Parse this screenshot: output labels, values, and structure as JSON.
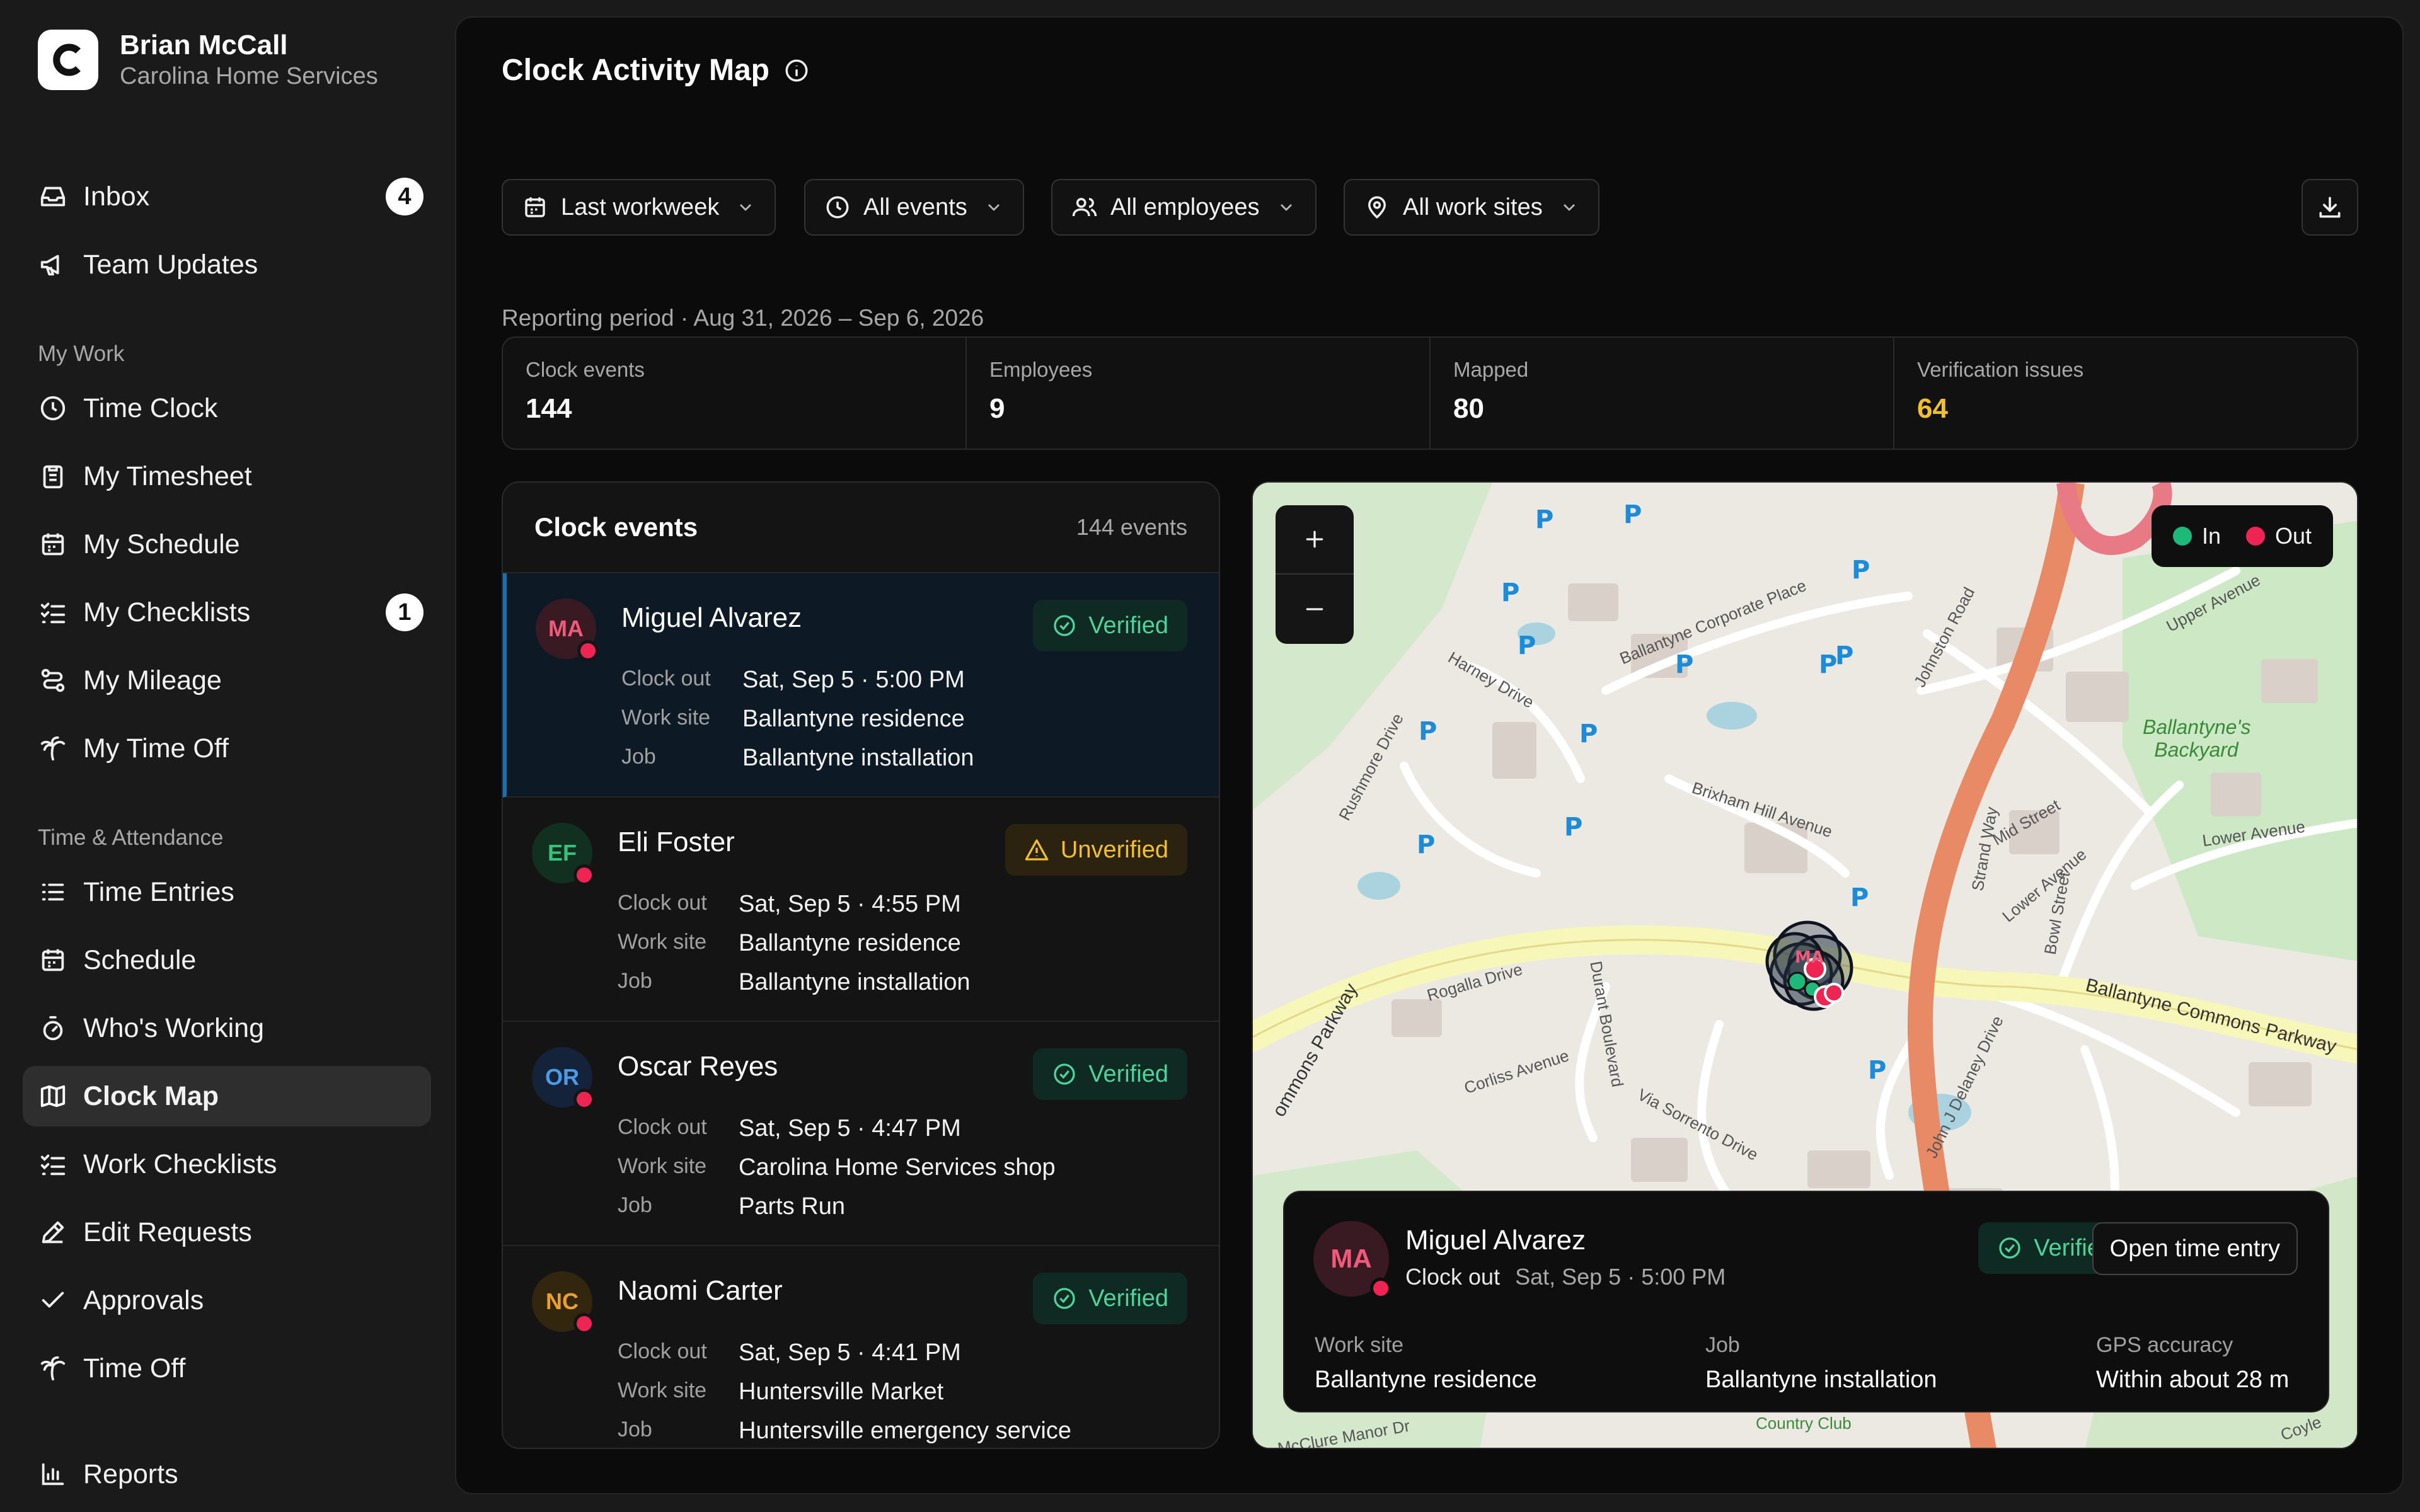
{
  "user": {
    "name": "Brian McCall",
    "org": "Carolina Home Services"
  },
  "nav": {
    "inbox": {
      "label": "Inbox",
      "badge": "4"
    },
    "team_updates": {
      "label": "Team Updates"
    },
    "section_my_work": "My Work",
    "time_clock": {
      "label": "Time Clock"
    },
    "my_timesheet": {
      "label": "My Timesheet"
    },
    "my_schedule": {
      "label": "My Schedule"
    },
    "my_checklists": {
      "label": "My Checklists",
      "badge": "1"
    },
    "my_mileage": {
      "label": "My Mileage"
    },
    "my_time_off": {
      "label": "My Time Off"
    },
    "section_time_attendance": "Time & Attendance",
    "time_entries": {
      "label": "Time Entries"
    },
    "schedule": {
      "label": "Schedule"
    },
    "whos_working": {
      "label": "Who's Working"
    },
    "clock_map": {
      "label": "Clock Map"
    },
    "work_checklists": {
      "label": "Work Checklists"
    },
    "edit_requests": {
      "label": "Edit Requests"
    },
    "approvals": {
      "label": "Approvals"
    },
    "time_off": {
      "label": "Time Off"
    },
    "reports": {
      "label": "Reports"
    }
  },
  "page": {
    "title": "Clock Activity Map"
  },
  "filters": {
    "period": "Last workweek",
    "events": "All events",
    "employees": "All employees",
    "sites": "All work sites"
  },
  "reporting_period": "Reporting period · Aug 31, 2026 – Sep 6, 2026",
  "stats": {
    "clock_events": {
      "label": "Clock events",
      "value": "144"
    },
    "employees": {
      "label": "Employees",
      "value": "9"
    },
    "mapped": {
      "label": "Mapped",
      "value": "80"
    },
    "issues": {
      "label": "Verification issues",
      "value": "64"
    }
  },
  "events_panel": {
    "title": "Clock events",
    "count": "144 events",
    "field_labels": {
      "event": "Clock out",
      "site": "Work site",
      "job": "Job"
    },
    "items": [
      {
        "initials": "MA",
        "name": "Miguel Alvarez",
        "status": "Verified",
        "time": "Sat, Sep 5 · 5:00 PM",
        "site": "Ballantyne residence",
        "job": "Ballantyne installation"
      },
      {
        "initials": "EF",
        "name": "Eli Foster",
        "status": "Unverified",
        "time": "Sat, Sep 5 · 4:55 PM",
        "site": "Ballantyne residence",
        "job": "Ballantyne installation"
      },
      {
        "initials": "OR",
        "name": "Oscar Reyes",
        "status": "Verified",
        "time": "Sat, Sep 5 · 4:47 PM",
        "site": "Carolina Home Services shop",
        "job": "Parts Run"
      },
      {
        "initials": "NC",
        "name": "Naomi Carter",
        "status": "Verified",
        "time": "Sat, Sep 5 · 4:41 PM",
        "site": "Huntersville Market",
        "job": "Huntersville emergency service"
      }
    ]
  },
  "map": {
    "legend_in": "In",
    "legend_out": "Out",
    "colors": {
      "in": "#1db97a",
      "out": "#ee2453"
    },
    "labels": {
      "ballantyne_corporate": "Ballantyne Corporate Place",
      "johnston": "Johnston Road",
      "harney": "Harney Drive",
      "rushmore": "Rushmore Drive",
      "brixham": "Brixham Hill Avenue",
      "upper": "Upper Avenue",
      "backyard": "Ballantyne's Backyard",
      "lower": "Lower Avenue",
      "mid": "Mid Street",
      "lower2": "Lower Avenue",
      "bowl": "Bowl Street",
      "strand": "Strand Way",
      "commons": "Ballantyne Commons Parkway",
      "commons_left": "ommons Parkway",
      "rogalla": "Rogalla Drive",
      "durant": "Durant Boulevard",
      "corliss": "Corliss Avenue",
      "sorrento": "Via Sorrento Drive",
      "delaney": "John J Delaney Drive",
      "mcclure": "McClure Manor Dr",
      "country": "Country Club",
      "coyle": "Coyle"
    },
    "marker_initials": "MA",
    "popup": {
      "initials": "MA",
      "name": "Miguel Alvarez",
      "event": "Clock out",
      "time": "Sat, Sep 5 · 5:00 PM",
      "status": "Verified",
      "open_label": "Open time entry",
      "site_label": "Work site",
      "site": "Ballantyne residence",
      "job_label": "Job",
      "job": "Ballantyne installation",
      "gps_label": "GPS accuracy",
      "gps": "Within about 28 m"
    }
  }
}
